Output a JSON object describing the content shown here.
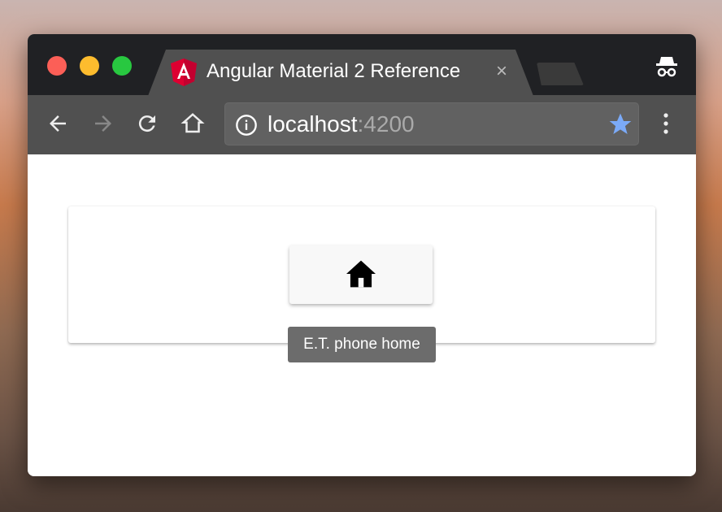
{
  "browser": {
    "tab_title": "Angular Material 2 Reference",
    "tab_close": "×",
    "url_host": "localhost",
    "url_port": ":4200",
    "icons": [
      "angular-logo",
      "back-arrow",
      "forward-arrow",
      "reload",
      "home",
      "info",
      "star",
      "more-vert",
      "incognito"
    ],
    "star_color": "#7baaf7"
  },
  "page": {
    "button_icon": "home",
    "tooltip": "E.T. phone home"
  }
}
